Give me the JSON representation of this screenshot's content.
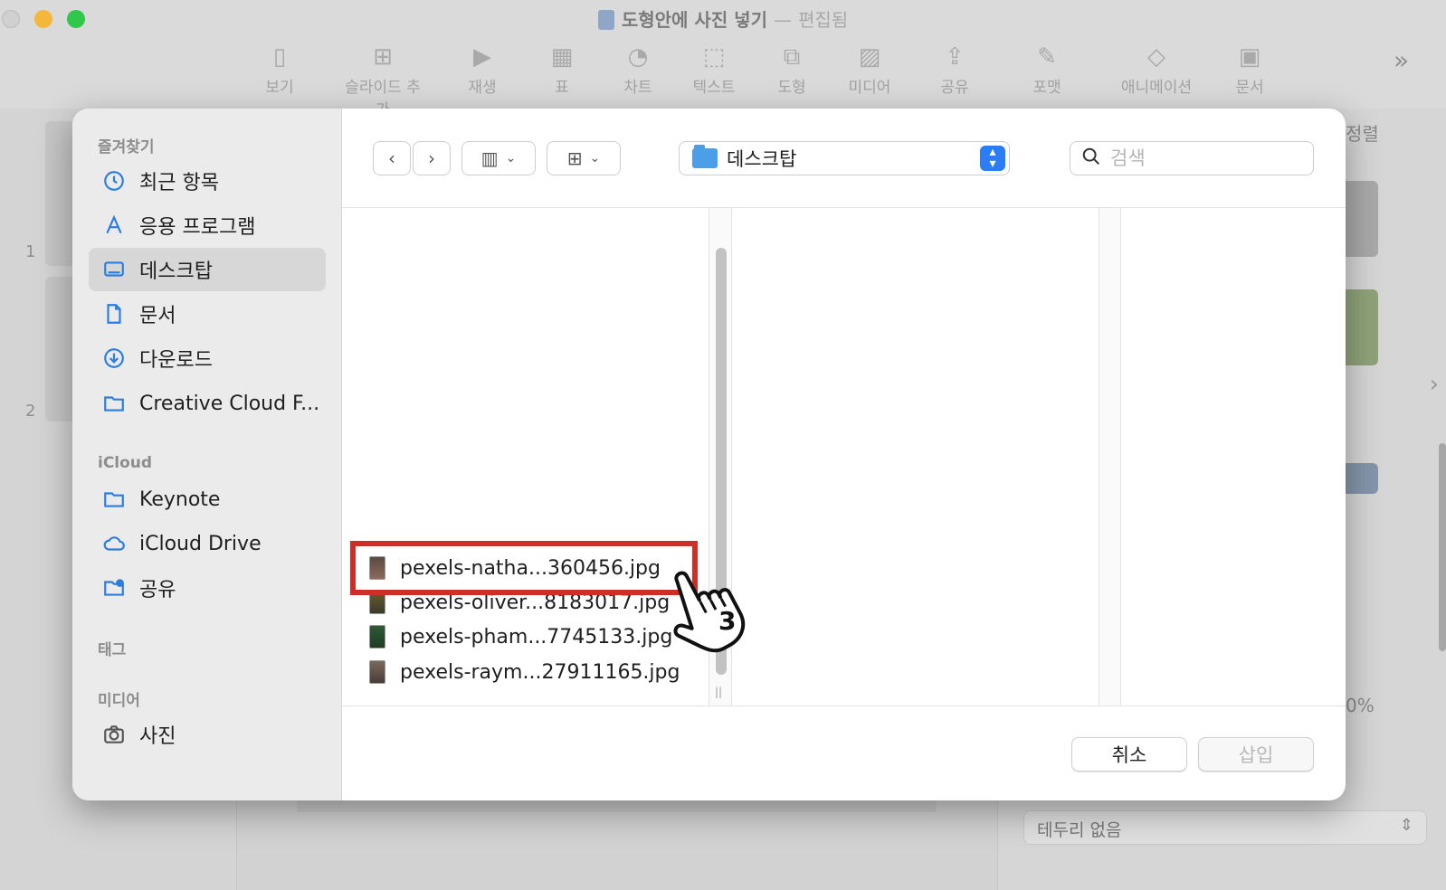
{
  "window": {
    "title": "도형안에 사진 넣기",
    "separator": "—",
    "status": "편집됨"
  },
  "toolbar": {
    "items": [
      {
        "label": "보기",
        "icon": "sidebar-icon"
      },
      {
        "label": "슬라이드 추가",
        "icon": "add-slide-icon"
      },
      {
        "label": "재생",
        "icon": "play-icon"
      },
      {
        "label": "표",
        "icon": "table-icon"
      },
      {
        "label": "차트",
        "icon": "chart-icon"
      },
      {
        "label": "텍스트",
        "icon": "text-icon"
      },
      {
        "label": "도형",
        "icon": "shape-icon"
      },
      {
        "label": "미디어",
        "icon": "media-icon"
      },
      {
        "label": "공유",
        "icon": "share-icon"
      },
      {
        "label": "포맷",
        "icon": "format-brush-icon"
      },
      {
        "label": "애니메이션",
        "icon": "animate-icon"
      },
      {
        "label": "문서",
        "icon": "document-icon"
      }
    ],
    "more": "»"
  },
  "slides": {
    "numbers": [
      "1",
      "2"
    ]
  },
  "inspector": {
    "tab_partial": "정렬",
    "border_select": "테두리 없음",
    "percent_partial": "0%"
  },
  "dialog": {
    "sidebar": {
      "favorites_header": "즐겨찾기",
      "favorites": [
        {
          "label": "최근 항목",
          "icon": "clock-icon"
        },
        {
          "label": "응용 프로그램",
          "icon": "applications-icon"
        },
        {
          "label": "데스크탑",
          "icon": "desktop-icon",
          "selected": true
        },
        {
          "label": "문서",
          "icon": "document-icon"
        },
        {
          "label": "다운로드",
          "icon": "download-icon"
        },
        {
          "label": "Creative Cloud F...",
          "icon": "folder-icon"
        }
      ],
      "icloud_header": "iCloud",
      "icloud": [
        {
          "label": "Keynote",
          "icon": "folder-icon"
        },
        {
          "label": "iCloud Drive",
          "icon": "cloud-icon"
        },
        {
          "label": "공유",
          "icon": "shared-folder-icon"
        }
      ],
      "tags_header": "태그",
      "media_header": "미디어",
      "media": [
        {
          "label": "사진",
          "icon": "camera-icon"
        }
      ]
    },
    "location": "데스크탑",
    "search_placeholder": "검색",
    "files": [
      "pexels-natha...360456.jpg",
      "pexels-oliver...8183017.jpg",
      "pexels-pham...7745133.jpg",
      "pexels-raym...27911165.jpg"
    ],
    "cancel_label": "취소",
    "insert_label": "삽입"
  },
  "annotation": {
    "step_number": "3",
    "highlight_color": "#d12d27"
  }
}
